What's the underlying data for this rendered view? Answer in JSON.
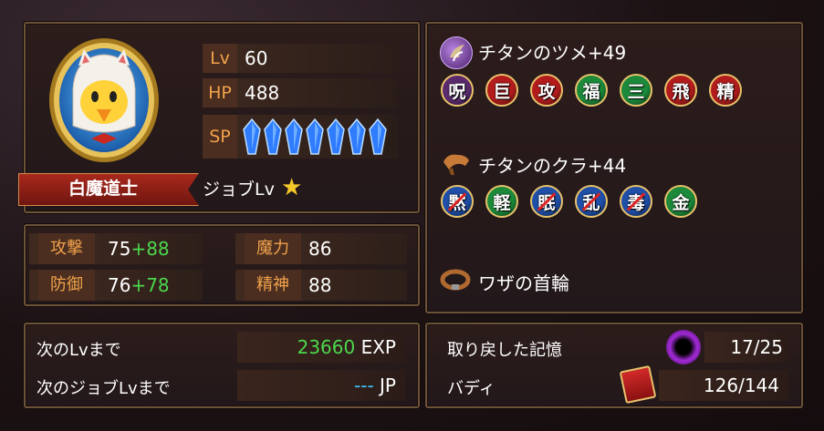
{
  "character": {
    "job_name": "白魔道士",
    "job_level_label": "ジョブLv",
    "lv_label": "Lv",
    "lv_value": "60",
    "hp_label": "HP",
    "hp_value": "488",
    "sp_label": "SP",
    "sp_crystals": 7,
    "icon": "chocobo-white-mage-portrait"
  },
  "stats": {
    "attack": {
      "label": "攻撃",
      "base": "75",
      "bonus": "+88"
    },
    "defense": {
      "label": "防御",
      "base": "76",
      "bonus": "+78"
    },
    "magic": {
      "label": "魔力",
      "value": "86"
    },
    "spirit": {
      "label": "精神",
      "value": "88"
    }
  },
  "equipment": {
    "weapon": {
      "name": "チタンのツメ+49",
      "icon": "claw-weapon-icon",
      "abilities": [
        {
          "char": "呪",
          "color": "#5b2a6e",
          "name": "curse",
          "blocked": false
        },
        {
          "char": "巨",
          "color": "#b31c1c",
          "name": "giant",
          "blocked": false
        },
        {
          "char": "攻",
          "color": "#b31c1c",
          "name": "attack",
          "blocked": false
        },
        {
          "char": "福",
          "color": "#1c8a3a",
          "name": "fortune",
          "blocked": false
        },
        {
          "char": "三",
          "color": "#1c8a3a",
          "name": "triple",
          "blocked": false
        },
        {
          "char": "飛",
          "color": "#b31c1c",
          "name": "flight",
          "blocked": false
        },
        {
          "char": "精",
          "color": "#b31c1c",
          "name": "spirit",
          "blocked": false
        }
      ]
    },
    "armor": {
      "name": "チタンのクラ+44",
      "icon": "saddle-armor-icon",
      "abilities": [
        {
          "char": "黙",
          "color": "#1f4fa8",
          "name": "silence",
          "blocked": true
        },
        {
          "char": "軽",
          "color": "#1c8a3a",
          "name": "light",
          "blocked": false
        },
        {
          "char": "眠",
          "color": "#1f4fa8",
          "name": "sleep",
          "blocked": true
        },
        {
          "char": "乱",
          "color": "#1f4fa8",
          "name": "confuse",
          "blocked": true
        },
        {
          "char": "毒",
          "color": "#1f4fa8",
          "name": "poison",
          "blocked": true
        },
        {
          "char": "金",
          "color": "#1c8a3a",
          "name": "gold",
          "blocked": false
        }
      ]
    },
    "accessory": {
      "name": "ワザの首輪",
      "icon": "collar-accessory-icon"
    }
  },
  "progress": {
    "next_lv_label": "次のLvまで",
    "next_lv_value": "23660",
    "next_lv_unit": "EXP",
    "next_job_label": "次のジョブLvまで",
    "next_job_value": "---",
    "next_job_unit": "JP",
    "memory_label": "取り戻した記憶",
    "memory_value": "17/25",
    "buddy_label": "バディ",
    "buddy_value": "126/144"
  },
  "colors": {
    "label_orange": "#f0a24a",
    "bonus_green": "#4cd84c",
    "exp_green": "#4cd84c",
    "jp_cyan": "#3cc8ff",
    "panel_border": "#6b5238"
  }
}
